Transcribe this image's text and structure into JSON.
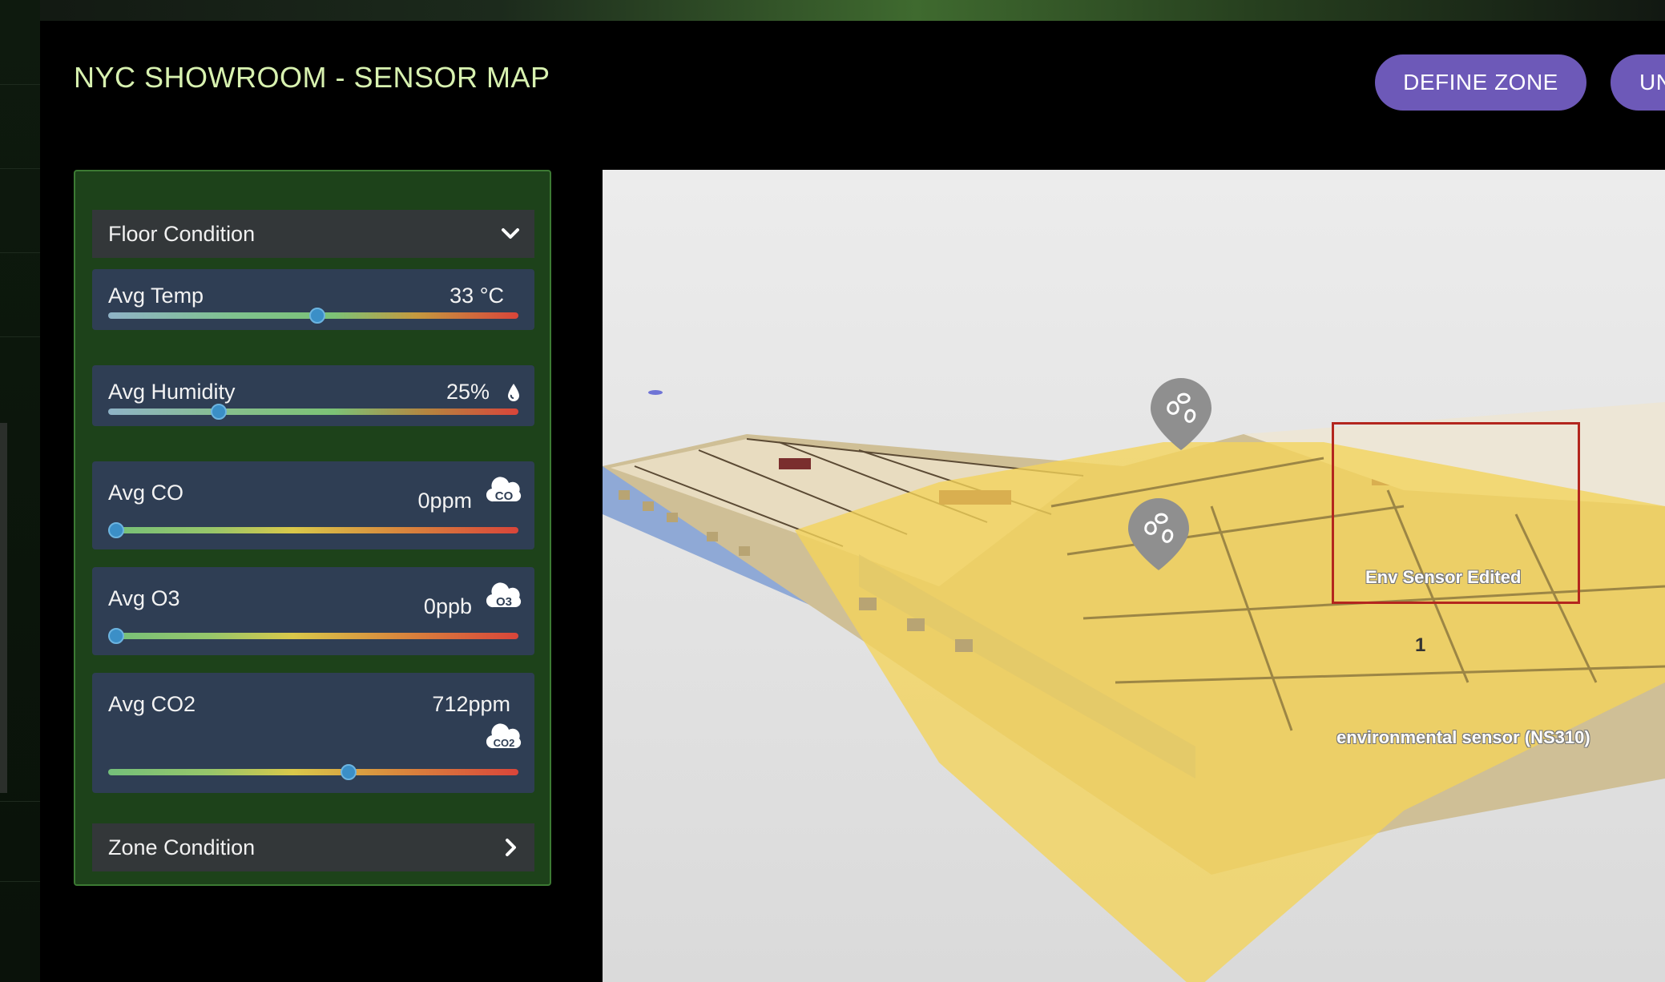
{
  "page": {
    "title": "NYC SHOWROOM - SENSOR MAP"
  },
  "header": {
    "define_zone_label": "DEFINE ZONE",
    "second_button_label": "UN"
  },
  "panel": {
    "floor_condition_label": "Floor Condition",
    "zone_condition_label": "Zone Condition",
    "metrics": [
      {
        "label": "Avg Temp",
        "value": "33 °C",
        "level": 0.51,
        "icon": "thermometer-none"
      },
      {
        "label": "Avg Humidity",
        "value": "25%",
        "level": 0.26,
        "icon": "droplet-icon"
      },
      {
        "label": "Avg CO",
        "value": "0ppm",
        "level": 0.0,
        "icon": "co-cloud-icon"
      },
      {
        "label": "Avg O3",
        "value": "0ppb",
        "level": 0.0,
        "icon": "o3-cloud-icon"
      },
      {
        "label": "Avg CO2",
        "value": "712ppm",
        "level": 0.59,
        "icon": "co2-cloud-icon"
      }
    ]
  },
  "map": {
    "sensors": [
      {
        "label": "Env Sensor Edited",
        "selected": true
      },
      {
        "label": "environmental sensor (NS310)",
        "badge": "1"
      }
    ],
    "colors": {
      "zone_fill": "#f3d35a",
      "selection": "#b3261e",
      "pin": "#8f8f8f"
    }
  },
  "icon_text": {
    "co": "CO",
    "o3": "O3",
    "co2": "CO2"
  },
  "colors": {
    "accent_button": "#6d59b8",
    "title_text": "#d8f2b0",
    "panel_bg": "#1d421a",
    "metric_bg": "#2f3e54",
    "knob": "#3b8fc7"
  }
}
